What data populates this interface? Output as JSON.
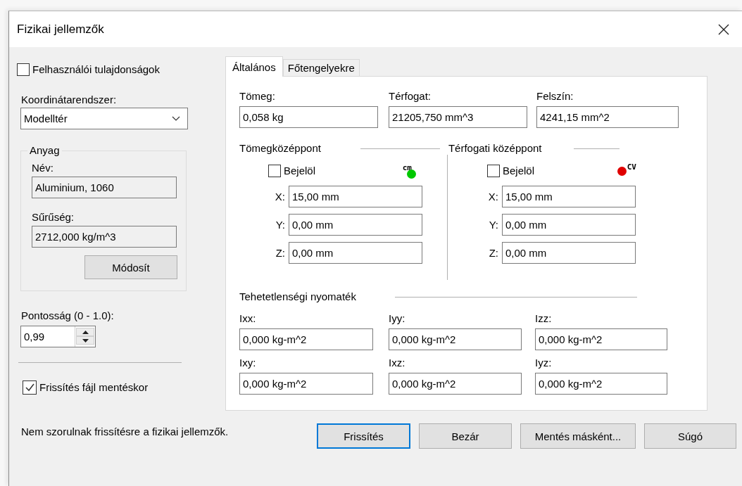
{
  "window": {
    "title": "Fizikai jellemzők"
  },
  "user_properties": {
    "label": "Felhasználói tulajdonságok",
    "checked": false
  },
  "coordinate_system": {
    "label": "Koordinátarendszer:",
    "value": "Modelltér"
  },
  "material": {
    "title": "Anyag",
    "fields": [
      {
        "label": "Név:",
        "value": "Aluminium, 1060"
      },
      {
        "label": "Sűrűség:",
        "value": "2712,000 kg/m^3"
      }
    ],
    "button": "Módosít"
  },
  "accuracy": {
    "label": "Pontosság (0 - 1.0):",
    "value": "0,99"
  },
  "update_on_save": {
    "label": "Frissítés fájl mentéskor",
    "checked": true
  },
  "tabs": [
    {
      "label": "Általános",
      "selected": true
    },
    {
      "label": "Főtengelyekre",
      "selected": false
    }
  ],
  "summary": [
    {
      "label": "Tömeg:",
      "value": "0,058 kg"
    },
    {
      "label": "Térfogat:",
      "value": "21205,750 mm^3"
    },
    {
      "label": "Felszín:",
      "value": "4241,15 mm^2"
    }
  ],
  "centers": [
    {
      "title": "Tömegközéppont",
      "checkbox": {
        "label": "Bejelöl",
        "checked": false
      },
      "marker": {
        "kind": "above",
        "text": "cm",
        "color": "#00c800"
      },
      "coords": [
        {
          "label": "X:",
          "value": "15,00 mm"
        },
        {
          "label": "Y:",
          "value": "0,00 mm"
        },
        {
          "label": "Z:",
          "value": "0,00 mm"
        }
      ]
    },
    {
      "title": "Térfogati középpont",
      "checkbox": {
        "label": "Bejelöl",
        "checked": false
      },
      "marker": {
        "kind": "beside",
        "text": "CV",
        "color": "#e00000"
      },
      "coords": [
        {
          "label": "X:",
          "value": "15,00 mm"
        },
        {
          "label": "Y:",
          "value": "0,00 mm"
        },
        {
          "label": "Z:",
          "value": "0,00 mm"
        }
      ]
    }
  ],
  "inertia": {
    "title": "Tehetetlenségi nyomaték",
    "fields": [
      {
        "label": "Ixx:",
        "value": "0,000 kg-m^2"
      },
      {
        "label": "Iyy:",
        "value": "0,000 kg-m^2"
      },
      {
        "label": "Izz:",
        "value": "0,000 kg-m^2"
      },
      {
        "label": "Ixy:",
        "value": "0,000 kg-m^2"
      },
      {
        "label": "Ixz:",
        "value": "0,000 kg-m^2"
      },
      {
        "label": "Iyz:",
        "value": "0,000 kg-m^2"
      }
    ]
  },
  "status": "Nem szorulnak frissítésre a fizikai jellemzők.",
  "buttons": [
    {
      "label": "Frissítés",
      "default": true
    },
    {
      "label": "Bezár",
      "default": false
    },
    {
      "label": "Mentés másként...",
      "default": false
    },
    {
      "label": "Súgó",
      "default": false
    }
  ]
}
